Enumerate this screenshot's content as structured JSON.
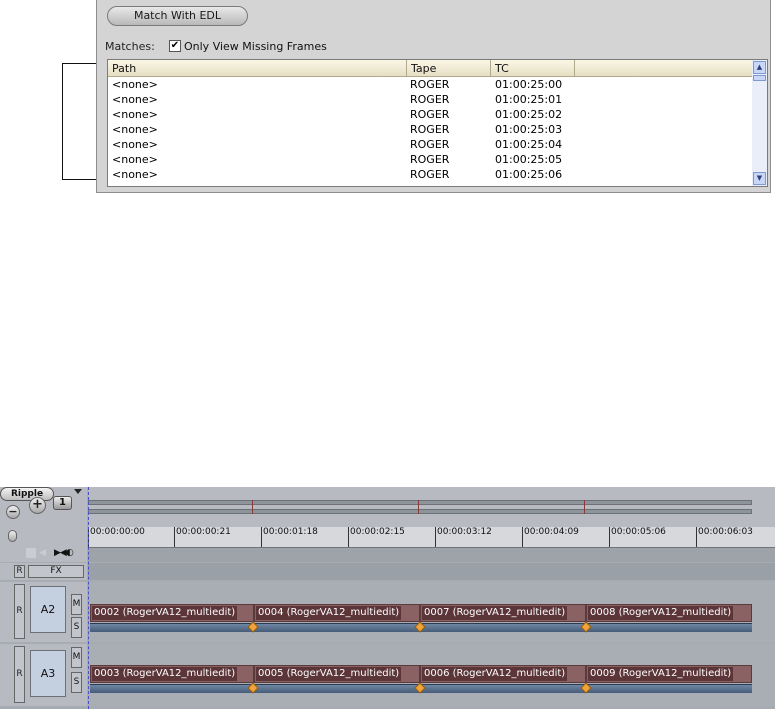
{
  "panel": {
    "match_button_label": "Match With EDL",
    "matches_label": "Matches:",
    "only_missing_label": "Only View Missing Frames",
    "only_missing_checked": true
  },
  "table": {
    "headers": [
      "Path",
      "Tape",
      "TC"
    ],
    "rows": [
      {
        "path": "<none>",
        "tape": "ROGER",
        "tc": "01:00:25:00"
      },
      {
        "path": "<none>",
        "tape": "ROGER",
        "tc": "01:00:25:01"
      },
      {
        "path": "<none>",
        "tape": "ROGER",
        "tc": "01:00:25:02"
      },
      {
        "path": "<none>",
        "tape": "ROGER",
        "tc": "01:00:25:03"
      },
      {
        "path": "<none>",
        "tape": "ROGER",
        "tc": "01:00:25:04"
      },
      {
        "path": "<none>",
        "tape": "ROGER",
        "tc": "01:00:25:05"
      },
      {
        "path": "<none>",
        "tape": "ROGER",
        "tc": "01:00:25:06"
      }
    ]
  },
  "timeline": {
    "ripple_label": "Ripple",
    "zoom_value": "1",
    "ruler_labels": [
      "00:00:00:00",
      "00:00:00:21",
      "00:00:01:18",
      "00:00:02:15",
      "00:00:03:12",
      "00:00:04:09",
      "00:00:05:06",
      "00:00:06:03"
    ],
    "fx_label": "FX",
    "r_label": "R",
    "m_label": "M",
    "s_label": "S",
    "tracks": [
      {
        "name": "A2",
        "clips": [
          "0002 (RogerVA12_multiedit)",
          "0004 (RogerVA12_multiedit)",
          "0007 (RogerVA12_multiedit)",
          "0008 (RogerVA12_multiedit)"
        ]
      },
      {
        "name": "A3",
        "clips": [
          "0003 (RogerVA12_multiedit)",
          "0005 (RogerVA12_multiedit)",
          "0006 (RogerVA12_multiedit)",
          "0009 (RogerVA12_multiedit)"
        ]
      }
    ]
  }
}
